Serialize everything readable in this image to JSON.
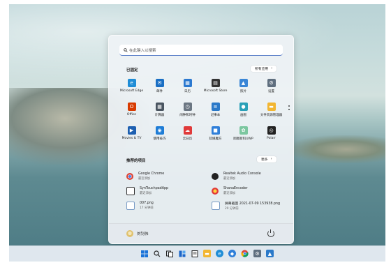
{
  "search": {
    "placeholder": "在此键入以搜索"
  },
  "pinned": {
    "title": "已固定",
    "all_apps_label": "所有应用",
    "apps": [
      {
        "label": "Microsoft Edge",
        "icon": "edge-icon",
        "color": "#1f8dd6",
        "glyph": "e"
      },
      {
        "label": "邮件",
        "icon": "mail-icon",
        "color": "#1a6fc4",
        "glyph": "✉"
      },
      {
        "label": "日历",
        "icon": "calendar-icon",
        "color": "#2b79d0",
        "glyph": "▦"
      },
      {
        "label": "Microsoft Store",
        "icon": "store-icon",
        "color": "#333333",
        "glyph": "▤"
      },
      {
        "label": "照片",
        "icon": "photos-icon",
        "color": "#3a86d6",
        "glyph": "▲"
      },
      {
        "label": "设置",
        "icon": "gear-icon",
        "color": "#5f6f7f",
        "glyph": "⚙"
      },
      {
        "label": "Office",
        "icon": "office-icon",
        "color": "#d83b01",
        "glyph": "O"
      },
      {
        "label": "计算器",
        "icon": "calculator-icon",
        "color": "#4a5561",
        "glyph": "▦"
      },
      {
        "label": "闹钟和时钟",
        "icon": "clock-icon",
        "color": "#6b7682",
        "glyph": "◷"
      },
      {
        "label": "记事本",
        "icon": "notepad-icon",
        "color": "#2a79c9",
        "glyph": "≡"
      },
      {
        "label": "画图",
        "icon": "paint-icon",
        "color": "#2aa0b8",
        "glyph": "●"
      },
      {
        "label": "文件资源管理器",
        "icon": "folder-icon",
        "color": "#f2b632",
        "glyph": "▬"
      },
      {
        "label": "Movies & TV",
        "icon": "movies-icon",
        "color": "#1d5fb0",
        "glyph": "▶"
      },
      {
        "label": "使用技巧",
        "icon": "tips-icon",
        "color": "#1f7dd6",
        "glyph": "◉"
      },
      {
        "label": "云日历",
        "icon": "cloud-calendar-icon",
        "color": "#e03a3a",
        "glyph": "☁"
      },
      {
        "label": "软媒魔方",
        "icon": "cube-icon",
        "color": "#2f7fd9",
        "glyph": "■"
      },
      {
        "label": "图图新科UWP",
        "icon": "anime-app-icon",
        "color": "#7cc7a0",
        "glyph": "✿"
      },
      {
        "label": "Polarr",
        "icon": "polarr-icon",
        "color": "#222222",
        "glyph": "◎"
      }
    ]
  },
  "recommended": {
    "title": "推荐的项目",
    "more_label": "更多",
    "items": [
      {
        "name": "Google Chrome",
        "sub": "最近添加",
        "icon": "chrome-icon"
      },
      {
        "name": "Realtek Audio Console",
        "sub": "最近添加",
        "icon": "realtek-icon"
      },
      {
        "name": "SynTouchpadApp",
        "sub": "最近添加",
        "icon": "touchpad-icon"
      },
      {
        "name": "ShanaEncoder",
        "sub": "最近添加",
        "icon": "shana-icon"
      },
      {
        "name": "007.png",
        "sub": "17 分钟前",
        "icon": "image-file-icon"
      },
      {
        "name": "屏幕截图 2021-07-09 153938.png",
        "sub": "20 分钟前",
        "icon": "image-file-icon"
      }
    ]
  },
  "user": {
    "name": "刘钊伟"
  },
  "colors": {
    "accent": "#0067c0",
    "start_bg": "#eef2f5",
    "taskbar_bg": "#dfe7ee"
  }
}
